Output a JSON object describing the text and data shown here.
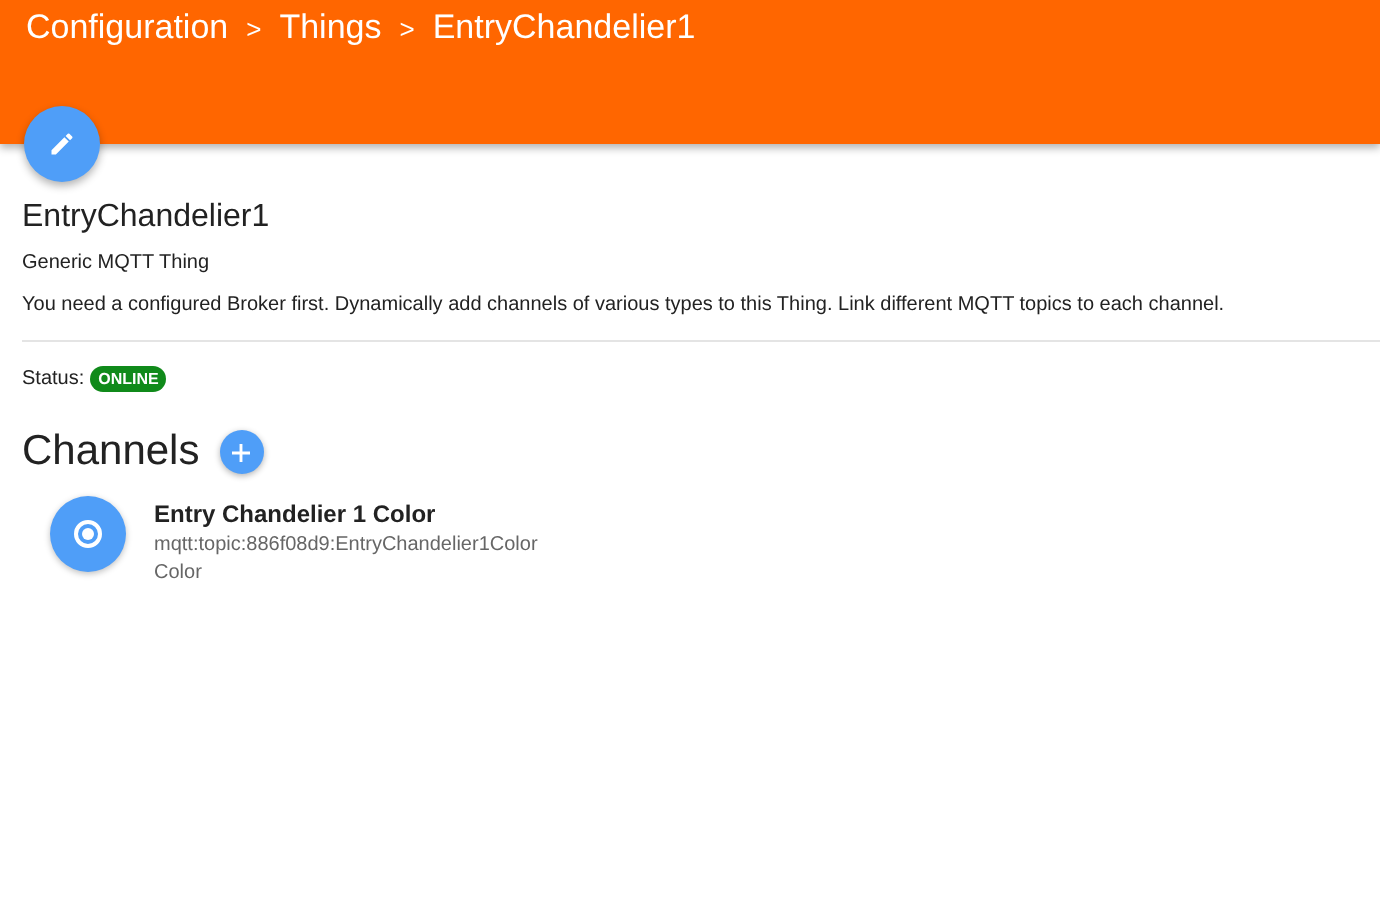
{
  "breadcrumb": [
    {
      "label": "Configuration",
      "separator": ">"
    },
    {
      "label": "Things",
      "separator": ">"
    },
    {
      "label": "EntryChandelier1"
    }
  ],
  "thing": {
    "title": "EntryChandelier1",
    "type": "Generic MQTT Thing",
    "description": "You need a configured Broker first. Dynamically add channels of various types to this Thing. Link different MQTT topics to each channel."
  },
  "status": {
    "label": "Status:",
    "value": "ONLINE",
    "kind": "online"
  },
  "channels_section": {
    "heading": "Channels"
  },
  "channels": [
    {
      "name": "Entry Chandelier 1 Color",
      "uid": "mqtt:topic:886f08d9:EntryChandelier1Color",
      "type": "Color"
    }
  ]
}
